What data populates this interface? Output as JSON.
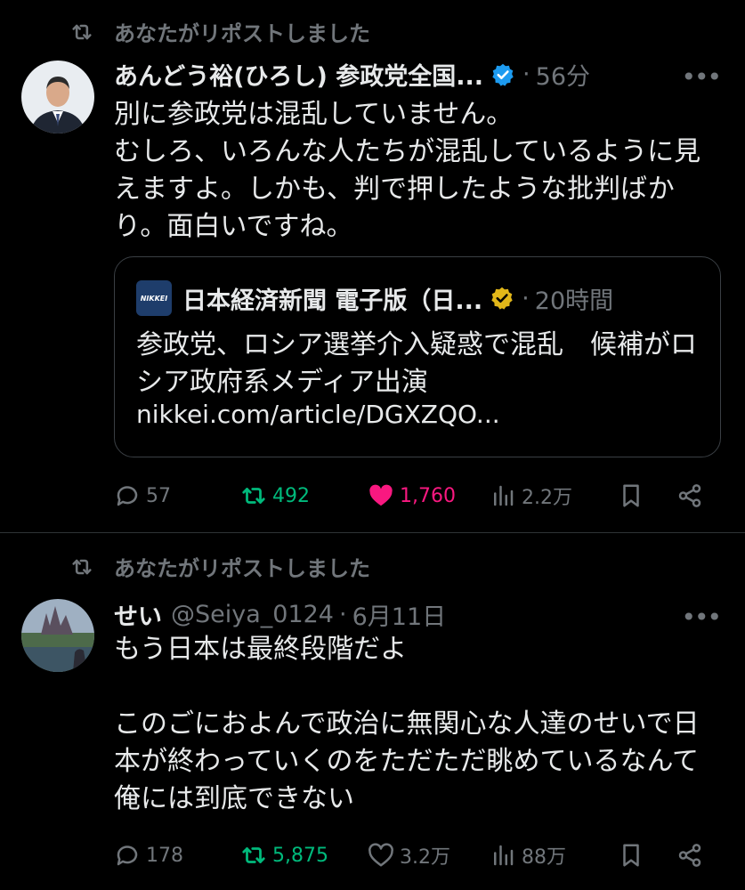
{
  "tweets": [
    {
      "repost_context": "あなたがリポストしました",
      "author_name": "あんどう裕(ひろし) 参政党全国...",
      "time": "56分",
      "text": "別に参政党は混乱していません。\nむしろ、いろんな人たちが混乱しているように見えますよ。しかも、判で押したような批判ばかり。面白いですね。",
      "quote": {
        "source_logo": "NIKKEI",
        "author_name": "日本経済新聞 電子版（日...",
        "time": "20時間",
        "text": "参政党、ロシア選挙介入疑惑で混乱　候補がロシア政府系メディア出演",
        "link": "nikkei.com/article/DGXZQO..."
      },
      "replies": "57",
      "reposts": "492",
      "likes": "1,760",
      "views": "2.2万",
      "colors": {
        "verified": "#1d9bf0",
        "repost_active": "#00ba7c",
        "like_active": "#f91880"
      }
    },
    {
      "repost_context": "あなたがリポストしました",
      "author_name": "せい",
      "handle": "@Seiya_0124",
      "time": "6月11日",
      "text": "もう日本は最終段階だよ\n\nこのごにおよんで政治に無関心な人達のせいで日本が終わっていくのをただただ眺めているなんて俺には到底できない",
      "replies": "178",
      "reposts": "5,875",
      "likes": "3.2万",
      "views": "88万"
    }
  ],
  "separator": "·",
  "more_glyph": "•••"
}
